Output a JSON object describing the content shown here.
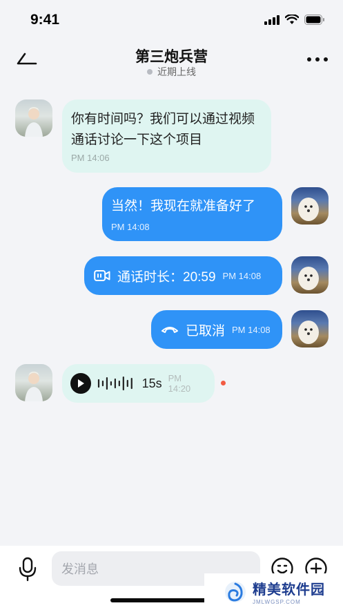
{
  "status_bar": {
    "time": "9:41"
  },
  "header": {
    "title": "第三炮兵营",
    "status": "近期上线"
  },
  "messages": [
    {
      "direction": "in",
      "type": "text",
      "text": "你有时间吗？我们可以通过视频通话讨论一下这个项目",
      "time": "PM 14:06"
    },
    {
      "direction": "out",
      "type": "text",
      "text": "当然！我现在就准备好了",
      "time": "PM 14:08"
    },
    {
      "direction": "out",
      "type": "video-call",
      "text": "通话时长：20:59",
      "time": "PM 14:08",
      "icon": "video-call-icon"
    },
    {
      "direction": "out",
      "type": "call-cancelled",
      "text": "已取消",
      "time": "PM 14:08",
      "icon": "hang-up-icon"
    },
    {
      "direction": "in",
      "type": "voice",
      "duration": "15s",
      "time": "PM 14:20",
      "unread": true
    }
  ],
  "input_bar": {
    "placeholder": "发消息"
  },
  "watermark": {
    "name": "精美软件园",
    "url": "JMLWGSP.COM"
  },
  "colors": {
    "accent": "#2f93f7",
    "incoming_bubble": "#dff5f1",
    "background": "#f3f4f7",
    "unread": "#f25b43"
  }
}
